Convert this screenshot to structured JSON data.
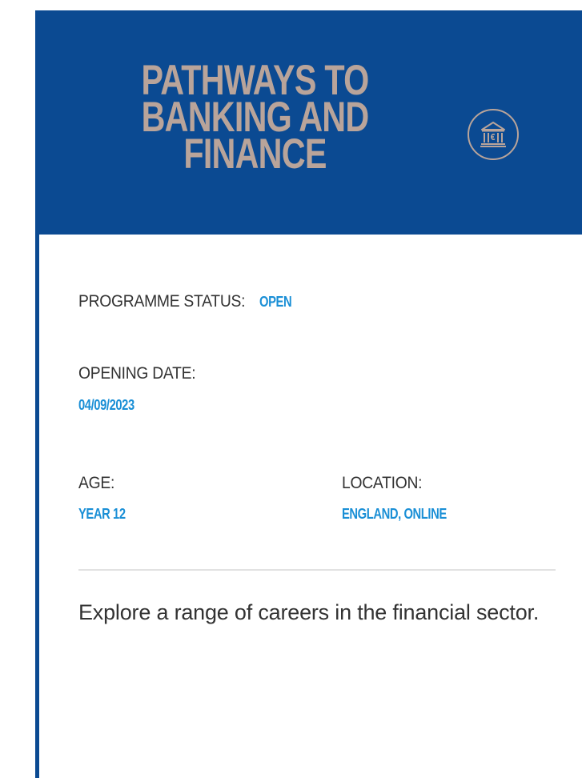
{
  "card": {
    "title": "PATHWAYS TO BANKING AND FINANCE",
    "icon": "bank-icon",
    "status_label": "PROGRAMME STATUS: ",
    "status_value": "OPEN",
    "opening_label": "OPENING DATE:",
    "opening_value": "04/09/2023",
    "age_label": "AGE:",
    "age_value": "YEAR 12",
    "location_label": "LOCATION:",
    "location_value": "ENGLAND, ONLINE",
    "description": "Explore a range of careers in the financial sector."
  },
  "colors": {
    "header_bg": "#0b4a92",
    "title": "#b9a49a",
    "value_accent": "#1a8fd6",
    "text": "#333333",
    "divider": "#e2e2e2"
  }
}
